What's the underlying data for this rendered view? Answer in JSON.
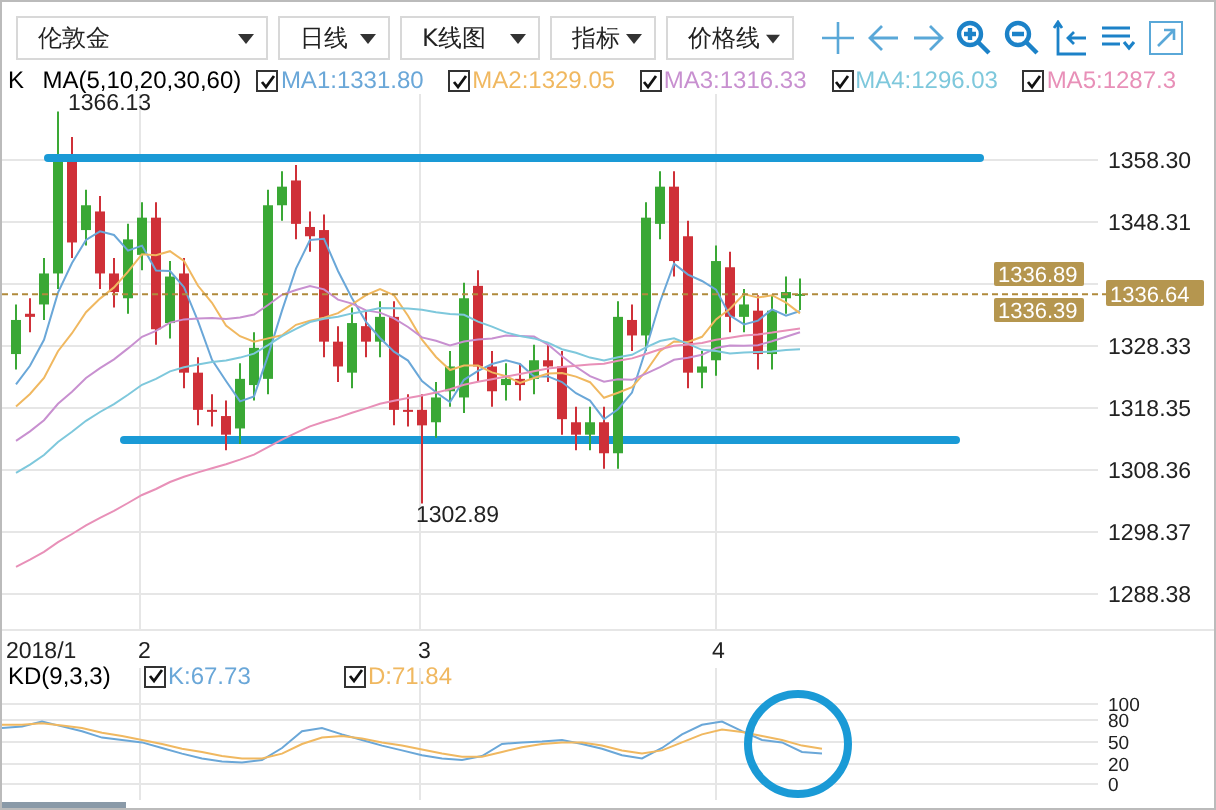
{
  "toolbar": {
    "dropdowns": [
      {
        "label": "伦敦金"
      },
      {
        "label": "日线"
      },
      {
        "label": "K线图"
      },
      {
        "label": "指标"
      },
      {
        "label": "价格线"
      }
    ]
  },
  "legend": {
    "symbol": "K",
    "indicator": "MA(5,10,20,30,60)",
    "lines": [
      {
        "label": "MA1:1331.80",
        "checked": true,
        "color": "#6aa7d8"
      },
      {
        "label": "MA2:1329.05",
        "checked": true,
        "color": "#f0b860"
      },
      {
        "label": "MA3:1316.33",
        "checked": true,
        "color": "#c890d0"
      },
      {
        "label": "MA4:1296.03",
        "checked": true,
        "color": "#7ec8dc"
      },
      {
        "label": "MA5:1287.3",
        "checked": true,
        "color": "#e890b8"
      }
    ]
  },
  "price_chart": {
    "high_label": "1366.13",
    "low_label": "1302.89",
    "price_tags": [
      "1336.89",
      "1336.39"
    ],
    "current_price": "1336.64",
    "y_axis": [
      "1358.30",
      "1348.31",
      "1328.33",
      "1318.35",
      "1308.36",
      "1298.37",
      "1288.38"
    ],
    "x_axis": [
      "2018/1",
      "2",
      "3",
      "4"
    ]
  },
  "kd": {
    "indicator": "KD(9,3,3)",
    "lines": [
      {
        "label": "K:67.73",
        "checked": true,
        "color": "#6aa7d8"
      },
      {
        "label": "D:71.84",
        "checked": true,
        "color": "#f0b860"
      }
    ],
    "y_axis": [
      "100",
      "80",
      "50",
      "20",
      "0"
    ]
  }
}
